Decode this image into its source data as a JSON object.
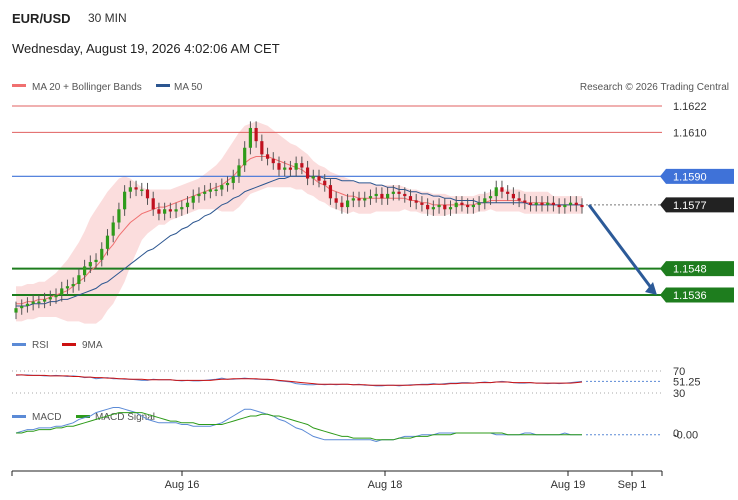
{
  "header": {
    "symbol": "EUR/USD",
    "timeframe": "30 MIN",
    "timestamp": "Wednesday, August 19, 2026 4:02:06 AM CET",
    "copyright": "Research © 2026 Trading Central"
  },
  "legend": {
    "price": [
      {
        "name": "MA 20 + Bollinger Bands",
        "color": "#f07070"
      },
      {
        "name": "MA 50",
        "color": "#2c5690"
      }
    ],
    "rsi": [
      {
        "name": "RSI",
        "color": "#5b8ad6"
      },
      {
        "name": "9MA",
        "color": "#cc1111"
      }
    ],
    "macd": [
      {
        "name": "MACD",
        "color": "#5b8ad6"
      },
      {
        "name": "MACD Signal",
        "color": "#2e9b1a"
      }
    ]
  },
  "chart_data": {
    "type": "candlestick",
    "x_ticks": [
      "Aug 16",
      "Aug 18",
      "Aug 19",
      "Sep 1"
    ],
    "price_levels": [
      {
        "value": "1.1622",
        "kind": "resistance",
        "color": "#e06060"
      },
      {
        "value": "1.1610",
        "kind": "resistance",
        "color": "#e06060"
      },
      {
        "value": "1.1590",
        "kind": "pivot",
        "color": "#3f72d8"
      },
      {
        "value": "1.1577",
        "kind": "last",
        "color": "#222222"
      },
      {
        "value": "1.1548",
        "kind": "support",
        "color": "#1e7d1e"
      },
      {
        "value": "1.1536",
        "kind": "support",
        "color": "#1e7d1e"
      }
    ],
    "close": [
      1.153,
      1.1531,
      1.1532,
      1.1533,
      1.1533,
      1.1534,
      1.1535,
      1.1536,
      1.1539,
      1.154,
      1.1541,
      1.1545,
      1.1549,
      1.1551,
      1.1552,
      1.1557,
      1.1563,
      1.1569,
      1.1575,
      1.1583,
      1.1585,
      1.1584,
      1.1584,
      1.158,
      1.1575,
      1.1573,
      1.1575,
      1.1574,
      1.1575,
      1.1576,
      1.1578,
      1.1581,
      1.1582,
      1.1583,
      1.1584,
      1.1584,
      1.1586,
      1.1587,
      1.159,
      1.1595,
      1.1603,
      1.1612,
      1.1606,
      1.16,
      1.1598,
      1.1596,
      1.1593,
      1.1594,
      1.1593,
      1.1596,
      1.1594,
      1.1589,
      1.159,
      1.1588,
      1.1586,
      1.158,
      1.1578,
      1.1576,
      1.1579,
      1.158,
      1.1579,
      1.158,
      1.1581,
      1.1582,
      1.158,
      1.1582,
      1.1583,
      1.1582,
      1.1581,
      1.1579,
      1.1578,
      1.1577,
      1.1575,
      1.1576,
      1.1577,
      1.1575,
      1.1576,
      1.1578,
      1.1577,
      1.1576,
      1.1577,
      1.1578,
      1.158,
      1.1581,
      1.1585,
      1.1583,
      1.1582,
      1.158,
      1.1579,
      1.1578,
      1.1577,
      1.1578,
      1.1577,
      1.1578,
      1.1577,
      1.1576,
      1.1577,
      1.1578,
      1.1577,
      1.1576
    ],
    "ma20": [
      1.1532,
      1.1532,
      1.1533,
      1.1533,
      1.1534,
      1.1534,
      1.1535,
      1.1536,
      1.1537,
      1.1538,
      1.154,
      1.1542,
      1.1544,
      1.1547,
      1.1549,
      1.1552,
      1.1556,
      1.1559,
      1.1563,
      1.1566,
      1.1569,
      1.1571,
      1.1573,
      1.1574,
      1.1575,
      1.1576,
      1.1576,
      1.1577,
      1.1578,
      1.1579,
      1.158,
      1.1581,
      1.1582,
      1.1583,
      1.1584,
      1.1585,
      1.1586,
      1.1588,
      1.159,
      1.1593,
      1.1596,
      1.1598,
      1.1599,
      1.1599,
      1.1599,
      1.1598,
      1.1597,
      1.1596,
      1.1595,
      1.1594,
      1.1593,
      1.1591,
      1.1589,
      1.1587,
      1.1586,
      1.1584,
      1.1583,
      1.1582,
      1.1581,
      1.1581,
      1.158,
      1.158,
      1.158,
      1.158,
      1.158,
      1.158,
      1.158,
      1.158,
      1.158,
      1.1579,
      1.1579,
      1.1578,
      1.1578,
      1.1577,
      1.1577,
      1.1577,
      1.1577,
      1.1577,
      1.1577,
      1.1577,
      1.1577,
      1.1578,
      1.1578,
      1.1579,
      1.1579,
      1.1579,
      1.1579,
      1.1579,
      1.1579,
      1.1578,
      1.1578,
      1.1578,
      1.1578,
      1.1578,
      1.1577,
      1.1577,
      1.1577,
      1.1577,
      1.1577,
      1.1577
    ],
    "ma50": [
      1.1531,
      1.1531,
      1.1531,
      1.1532,
      1.1532,
      1.1532,
      1.1533,
      1.1533,
      1.1534,
      1.1534,
      1.1535,
      1.1536,
      1.1537,
      1.1538,
      1.1539,
      1.1541,
      1.1542,
      1.1544,
      1.1546,
      1.1548,
      1.155,
      1.1552,
      1.1554,
      1.1556,
      1.1557,
      1.1559,
      1.1561,
      1.1563,
      1.1564,
      1.1566,
      1.1567,
      1.1569,
      1.157,
      1.1572,
      1.1573,
      1.1575,
      1.1577,
      1.1578,
      1.158,
      1.1581,
      1.1583,
      1.1584,
      1.1585,
      1.1586,
      1.1587,
      1.1588,
      1.1589,
      1.1589,
      1.159,
      1.159,
      1.159,
      1.159,
      1.159,
      1.159,
      1.1589,
      1.1589,
      1.1589,
      1.1588,
      1.1588,
      1.1588,
      1.1587,
      1.1587,
      1.1587,
      1.1586,
      1.1586,
      1.1585,
      1.1585,
      1.1584,
      1.1584,
      1.1583,
      1.1583,
      1.1582,
      1.1582,
      1.1581,
      1.1581,
      1.158,
      1.158,
      1.1579,
      1.1579,
      1.1579,
      1.1579,
      1.1578,
      1.1578,
      1.1578,
      1.1578,
      1.1578,
      1.1578,
      1.1578,
      1.1578,
      1.1578,
      1.1577,
      1.1577,
      1.1577,
      1.1577,
      1.1577,
      1.1577,
      1.1577,
      1.1577,
      1.1577,
      1.1577
    ],
    "bb_width": [
      0.0008,
      0.0008,
      0.0008,
      0.0008,
      0.0008,
      0.0008,
      0.0009,
      0.001,
      0.0012,
      0.0014,
      0.0016,
      0.0018,
      0.0021,
      0.0024,
      0.0026,
      0.0027,
      0.0027,
      0.0027,
      0.0026,
      0.0024,
      0.002,
      0.0016,
      0.0012,
      0.001,
      0.0009,
      0.0008,
      0.0008,
      0.0007,
      0.0007,
      0.0007,
      0.0007,
      0.0007,
      0.0007,
      0.0008,
      0.0009,
      0.001,
      0.0012,
      0.0014,
      0.0016,
      0.0017,
      0.0017,
      0.0016,
      0.0016,
      0.0015,
      0.0014,
      0.0013,
      0.0012,
      0.0011,
      0.001,
      0.001,
      0.0009,
      0.0009,
      0.0008,
      0.0008,
      0.0008,
      0.0008,
      0.0008,
      0.0008,
      0.0008,
      0.0007,
      0.0007,
      0.0007,
      0.0007,
      0.0006,
      0.0006,
      0.0006,
      0.0006,
      0.0006,
      0.0005,
      0.0005,
      0.0005,
      0.0005,
      0.0005,
      0.0005,
      0.0005,
      0.0005,
      0.0004,
      0.0004,
      0.0004,
      0.0004,
      0.0004,
      0.0004,
      0.0004,
      0.0004,
      0.0005,
      0.0005,
      0.0005,
      0.0005,
      0.0005,
      0.0005,
      0.0005,
      0.0005,
      0.0005,
      0.0005,
      0.0004,
      0.0004,
      0.0004,
      0.0004,
      0.0004,
      0.0004
    ],
    "forecast": {
      "from": "1.1577",
      "to": "1.1536"
    },
    "rsi": {
      "levels": [
        "70",
        "30"
      ],
      "last": "51.25",
      "values": [
        62,
        63,
        63,
        62,
        62,
        61,
        61,
        62,
        61,
        60,
        61,
        60,
        58,
        59,
        56,
        57,
        58,
        56,
        56,
        55,
        55,
        54,
        53,
        53,
        55,
        54,
        54,
        54,
        53,
        52,
        53,
        52,
        52,
        53,
        54,
        55,
        57,
        55,
        55,
        56,
        57,
        56,
        55,
        55,
        54,
        54,
        52,
        51,
        50,
        47,
        46,
        45,
        45,
        46,
        45,
        46,
        45,
        46,
        46,
        45,
        46,
        44,
        44,
        43,
        43,
        44,
        44,
        43,
        44,
        45,
        45,
        46,
        46,
        47,
        46,
        47,
        48,
        48,
        49,
        49,
        48,
        49,
        50,
        49,
        50,
        51,
        50,
        49,
        48,
        48,
        49,
        48,
        48,
        47,
        48,
        47,
        48,
        49,
        50,
        51
      ],
      "ma9": [
        63,
        63,
        62,
        62,
        62,
        62,
        61,
        61,
        61,
        61,
        60,
        60,
        59,
        59,
        58,
        58,
        57,
        57,
        56,
        56,
        55,
        55,
        55,
        54,
        54,
        54,
        54,
        54,
        53,
        53,
        53,
        53,
        53,
        53,
        53,
        54,
        55,
        55,
        56,
        56,
        56,
        56,
        56,
        55,
        55,
        54,
        53,
        52,
        51,
        50,
        49,
        48,
        47,
        46,
        46,
        46,
        46,
        46,
        46,
        45,
        45,
        45,
        44,
        44,
        44,
        44,
        44,
        44,
        44,
        44,
        45,
        45,
        45,
        46,
        46,
        46,
        47,
        47,
        48,
        48,
        48,
        49,
        49,
        49,
        50,
        50,
        50,
        49,
        49,
        49,
        49,
        48,
        48,
        48,
        48,
        48,
        48,
        48,
        49,
        50
      ]
    },
    "macd": {
      "zero": "0",
      "last": "-0.00",
      "values": [
        0.0,
        0.0001,
        0.0002,
        0.0002,
        0.0003,
        0.0003,
        0.0003,
        0.0004,
        0.0004,
        0.0005,
        0.0006,
        0.0008,
        0.0009,
        0.001,
        0.0012,
        0.0013,
        0.0014,
        0.0015,
        0.0015,
        0.0014,
        0.0013,
        0.0012,
        0.001,
        0.0008,
        0.0007,
        0.0006,
        0.0006,
        0.0006,
        0.0006,
        0.0005,
        0.0005,
        0.0004,
        0.0004,
        0.0004,
        0.0004,
        0.0005,
        0.0006,
        0.0008,
        0.001,
        0.0012,
        0.0014,
        0.0014,
        0.0013,
        0.0012,
        0.0011,
        0.001,
        0.0008,
        0.0007,
        0.0005,
        0.0003,
        0.0002,
        0.0,
        -0.0002,
        -0.0003,
        -0.0004,
        -0.0004,
        -0.0004,
        -0.0004,
        -0.0004,
        -0.0004,
        -0.0004,
        -0.0004,
        -0.0004,
        -0.0005,
        -0.0004,
        -0.0004,
        -0.0004,
        -0.0003,
        -0.0002,
        -0.0002,
        -0.0002,
        -0.0001,
        -0.0001,
        -0.0001,
        0.0,
        0.0,
        0.0,
        0.0,
        0.0,
        0.0,
        0.0,
        0.0,
        0.0,
        0.0,
        -0.0001,
        -0.0001,
        -0.0001,
        -0.0001,
        -0.0001,
        0.0,
        0.0,
        -0.0001,
        -0.0001,
        -0.0001,
        -0.0001,
        -0.0001,
        0.0,
        -0.0001,
        -0.0001,
        -0.0001
      ],
      "signal": [
        0.0,
        0.0,
        0.0001,
        0.0001,
        0.0002,
        0.0002,
        0.0002,
        0.0003,
        0.0003,
        0.0004,
        0.0004,
        0.0005,
        0.0006,
        0.0007,
        0.0008,
        0.0009,
        0.001,
        0.0011,
        0.0012,
        0.0012,
        0.0012,
        0.0012,
        0.0012,
        0.0011,
        0.001,
        0.0009,
        0.0008,
        0.0007,
        0.0007,
        0.0006,
        0.0006,
        0.0006,
        0.0005,
        0.0005,
        0.0005,
        0.0005,
        0.0005,
        0.0006,
        0.0007,
        0.0008,
        0.0009,
        0.001,
        0.001,
        0.0011,
        0.0011,
        0.001,
        0.001,
        0.0009,
        0.0008,
        0.0007,
        0.0006,
        0.0005,
        0.0003,
        0.0002,
        0.0001,
        0.0,
        -0.0001,
        -0.0002,
        -0.0002,
        -0.0003,
        -0.0003,
        -0.0003,
        -0.0003,
        -0.0004,
        -0.0004,
        -0.0004,
        -0.0004,
        -0.0003,
        -0.0003,
        -0.0003,
        -0.0002,
        -0.0002,
        -0.0002,
        -0.0001,
        -0.0001,
        -0.0001,
        -0.0001,
        0.0,
        0.0,
        0.0,
        0.0,
        0.0,
        0.0,
        0.0,
        0.0,
        0.0,
        -0.0001,
        -0.0001,
        -0.0001,
        -0.0001,
        -0.0001,
        -0.0001,
        -0.0001,
        -0.0001,
        -0.0001,
        -0.0001,
        -0.0001,
        -0.0001,
        -0.0001,
        -0.0001
      ]
    }
  }
}
